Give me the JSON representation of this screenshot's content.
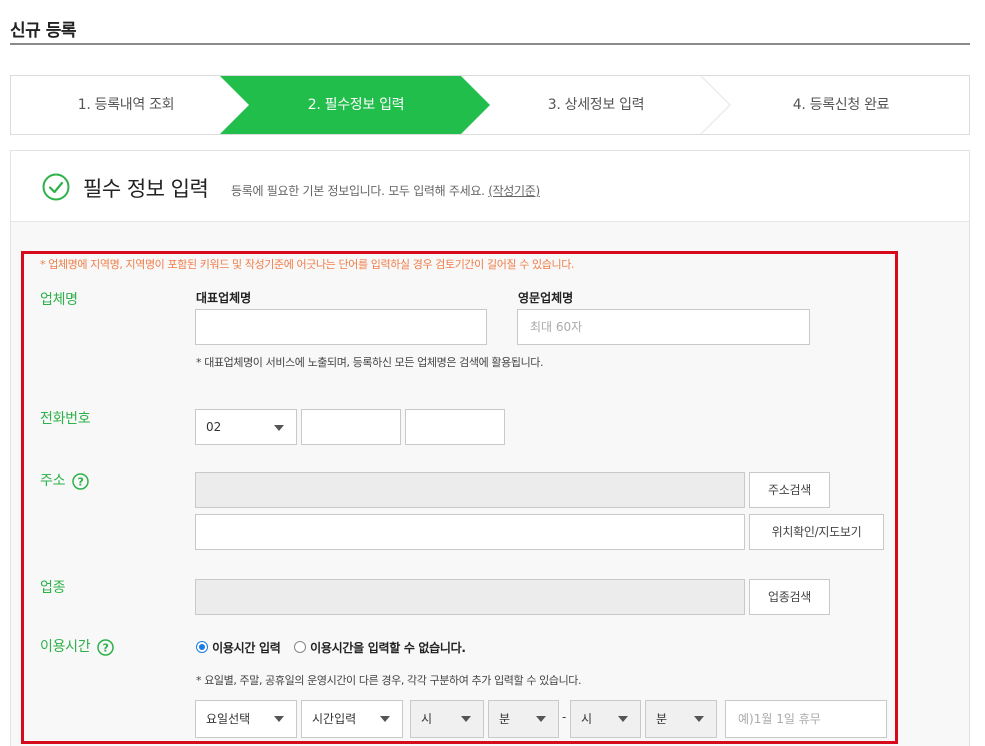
{
  "page": {
    "title": "신규 등록"
  },
  "steps": [
    {
      "label": "1. 등록내역 조회",
      "active": false
    },
    {
      "label": "2. 필수정보 입력",
      "active": true
    },
    {
      "label": "3. 상세정보 입력",
      "active": false
    },
    {
      "label": "4. 등록신청 완료",
      "active": false
    }
  ],
  "section": {
    "title": "필수 정보 입력",
    "desc": "등록에 필요한 기본 정보입니다. 모두 입력해 주세요.",
    "link": "(작성기준)",
    "check_icon": "check-circle-icon"
  },
  "form": {
    "notice": "* 업체명에 지역명, 지역명이 포함된 키워드 및 작성기준에 어긋나는 단어를 입력하실 경우 검토기간이 길어질 수 있습니다.",
    "company": {
      "label": "업체명",
      "main_label": "대표업체명",
      "main_value": "",
      "en_label": "영문업체명",
      "en_placeholder": "최대 60자",
      "hint": "* 대표업체명이 서비스에 노출되며, 등록하신 모든 업체명은 검색에 활용됩니다."
    },
    "phone": {
      "label": "전화번호",
      "area_code": "02",
      "middle": "",
      "last": ""
    },
    "address": {
      "label": "주소",
      "help_icon": "question-circle-icon",
      "search_button": "주소검색",
      "map_button": "위치확인/지도보기",
      "detail_value": ""
    },
    "business": {
      "label": "업종",
      "search_button": "업종검색"
    },
    "hours": {
      "label": "이용시간",
      "help_icon": "question-circle-icon",
      "option_input": "이용시간 입력",
      "option_none": "이용시간을 입력할 수 없습니다.",
      "selected": "이용시간 입력",
      "hint": "* 요일별, 주말, 공휴일의 운영시간이 다른 경우, 각각 구분하여 추가 입력할 수 있습니다.",
      "day_select": "요일선택",
      "time_select": "시간입력",
      "start_hour": "시",
      "start_min": "분",
      "separator": "-",
      "end_hour": "시",
      "end_min": "분",
      "holiday_placeholder": "예)1월 1일 휴무"
    }
  },
  "colors": {
    "accent_green": "#2db14a",
    "step_active": "#22be4b",
    "highlight_red": "#d70a1c",
    "notice_orange": "#ef7e4a"
  }
}
